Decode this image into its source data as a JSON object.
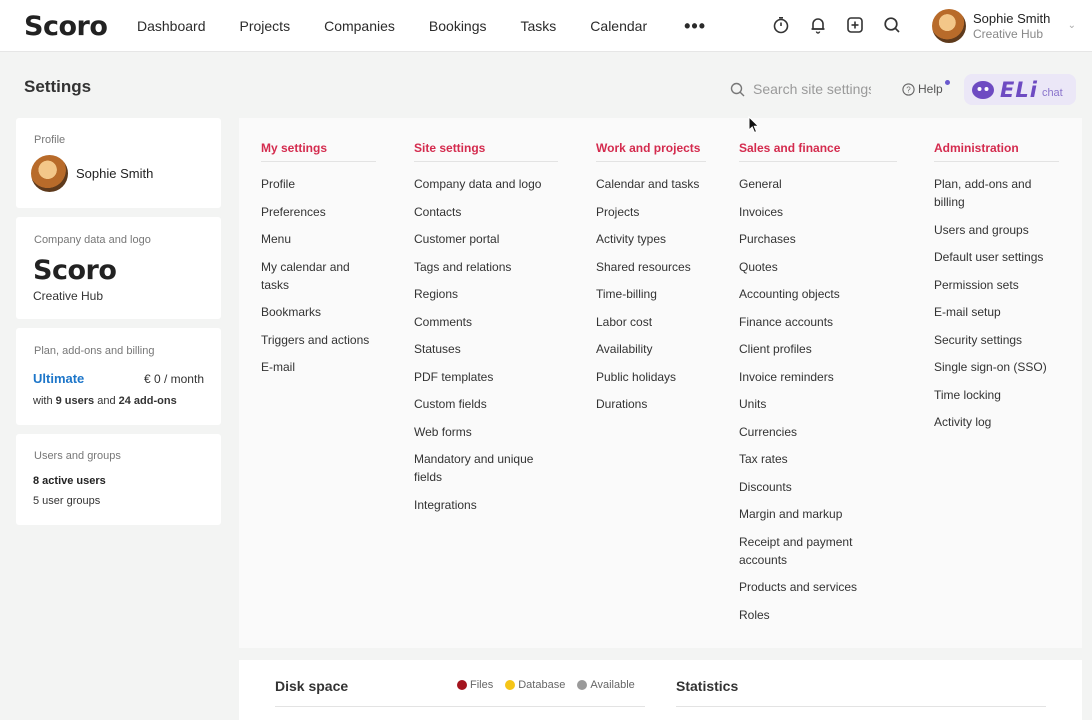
{
  "app": {
    "logo": "Scoro",
    "nav": [
      "Dashboard",
      "Projects",
      "Companies",
      "Bookings",
      "Tasks",
      "Calendar"
    ],
    "more": "•••",
    "user": {
      "name": "Sophie Smith",
      "company": "Creative Hub"
    }
  },
  "header": {
    "title": "Settings",
    "search_placeholder": "Search site settings",
    "help": "Help",
    "eli": "ELi",
    "eli_chat": "chat"
  },
  "cards": {
    "profile": {
      "label": "Profile",
      "name": "Sophie Smith"
    },
    "company": {
      "label": "Company data and logo",
      "logo": "Scoro",
      "name": "Creative Hub"
    },
    "plan": {
      "label": "Plan, add-ons and billing",
      "name": "Ultimate",
      "price": "€ 0 / month",
      "desc_prefix": "with ",
      "users": "9 users",
      "desc_mid": " and ",
      "addons": "24 add-ons"
    },
    "users": {
      "label": "Users and groups",
      "active": "8 active users",
      "groups": "5 user groups"
    }
  },
  "columns": [
    {
      "title": "My settings",
      "items": [
        "Profile",
        "Preferences",
        "Menu",
        "My calendar and tasks",
        "Bookmarks",
        "Triggers and actions",
        "E-mail"
      ]
    },
    {
      "title": "Site settings",
      "items": [
        "Company data and logo",
        "Contacts",
        "Customer portal",
        "Tags and relations",
        "Regions",
        "Comments",
        "Statuses",
        "PDF templates",
        "Custom fields",
        "Web forms",
        "Mandatory and unique fields",
        "Integrations"
      ]
    },
    {
      "title": "Work and projects",
      "items": [
        "Calendar and tasks",
        "Projects",
        "Activity types",
        "Shared resources",
        "Time-billing",
        "Labor cost",
        "Availability",
        "Public holidays",
        "Durations"
      ]
    },
    {
      "title": "Sales and finance",
      "items": [
        "General",
        "Invoices",
        "Purchases",
        "Quotes",
        "Accounting objects",
        "Finance accounts",
        "Client profiles",
        "Invoice reminders",
        "Units",
        "Currencies",
        "Tax rates",
        "Discounts",
        "Margin and markup",
        "Receipt and payment accounts",
        "Products and services",
        "Roles"
      ]
    },
    {
      "title": "Administration",
      "items": [
        "Plan, add-ons and billing",
        "Users and groups",
        "Default user settings",
        "Permission sets",
        "E-mail setup",
        "Security settings",
        "Single sign-on (SSO)",
        "Time locking",
        "Activity log"
      ]
    }
  ],
  "bottom": {
    "disk_title": "Disk space",
    "legend": [
      {
        "label": "Files",
        "color": "#a4141e"
      },
      {
        "label": "Database",
        "color": "#f5c518"
      },
      {
        "label": "Available",
        "color": "#9a9a9a"
      }
    ],
    "stats_title": "Statistics"
  },
  "colors": {
    "accent": "#d42b4e",
    "link": "#1d76c9",
    "brand": "#e3264a"
  }
}
